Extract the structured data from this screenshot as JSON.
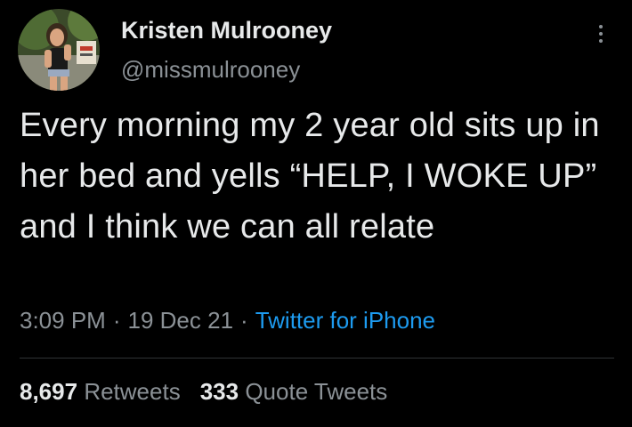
{
  "author": {
    "display_name": "Kristen Mulrooney",
    "handle": "@missmulrooney",
    "avatar_icon": "profile-photo"
  },
  "more_icon": "more-options-icon",
  "tweet": {
    "text": "Every morning my 2 year old sits up in her bed and yells “HELP, I WOKE UP” and I think we can all relate"
  },
  "meta": {
    "time": "3:09 PM",
    "date": "19 Dec 21",
    "separator": "·",
    "source": "Twitter for iPhone"
  },
  "stats": {
    "retweets_count": "8,697",
    "retweets_label": "Retweets",
    "quotes_count": "333",
    "quotes_label": "Quote Tweets"
  },
  "colors": {
    "background": "#000000",
    "primary_text": "#e7e9ea",
    "secondary_text": "#8b9196",
    "link": "#1d9bf0",
    "divider": "#2f3336"
  }
}
